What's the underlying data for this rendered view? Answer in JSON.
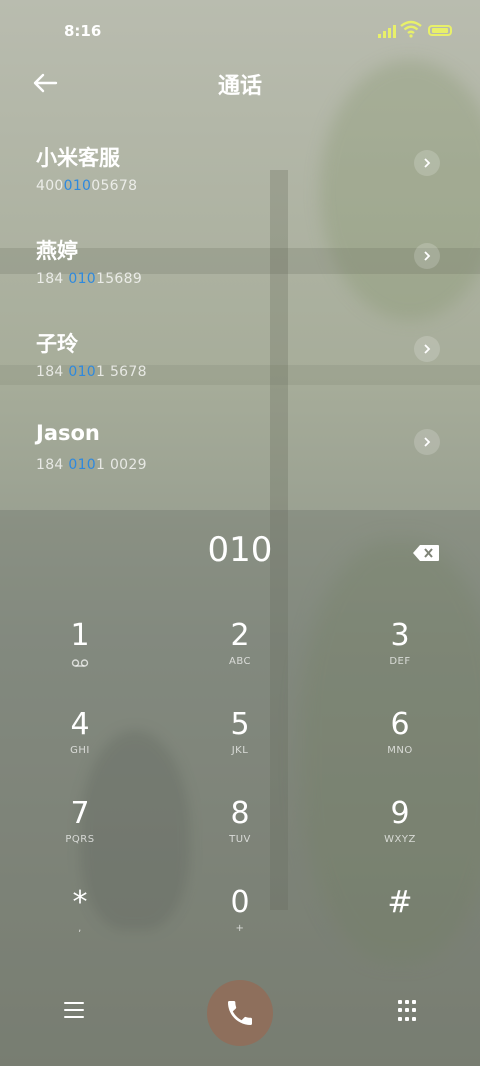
{
  "status_bar": {
    "time": "8:16"
  },
  "header": {
    "title": "通话",
    "back_icon": "arrow-left-icon"
  },
  "contacts": [
    {
      "name": "小米客服",
      "number_pre": "400",
      "number_match": "010",
      "number_post": "05678"
    },
    {
      "name": "燕婷",
      "number_pre": "184 ",
      "number_match": "010",
      "number_post": "15689"
    },
    {
      "name": "子玲",
      "number_pre": "184 ",
      "number_match": "010",
      "number_post": "1 5678"
    },
    {
      "name": "Jason",
      "number_pre": "184 ",
      "number_match": "010",
      "number_post": "1 0029"
    }
  ],
  "dialer": {
    "typed": "010",
    "keys": [
      {
        "digit": "1",
        "letters": ""
      },
      {
        "digit": "2",
        "letters": "ABC"
      },
      {
        "digit": "3",
        "letters": "DEF"
      },
      {
        "digit": "4",
        "letters": "GHI"
      },
      {
        "digit": "5",
        "letters": "JKL"
      },
      {
        "digit": "6",
        "letters": "MNO"
      },
      {
        "digit": "7",
        "letters": "PQRS"
      },
      {
        "digit": "8",
        "letters": "TUV"
      },
      {
        "digit": "9",
        "letters": "WXYZ"
      },
      {
        "digit": "*",
        "letters": ","
      },
      {
        "digit": "0",
        "letters": "+"
      },
      {
        "digit": "#",
        "letters": ""
      }
    ]
  },
  "colors": {
    "match_highlight": "#2e89de",
    "call_button": "#8e6f5c",
    "status_accent": "#e8f06a"
  }
}
